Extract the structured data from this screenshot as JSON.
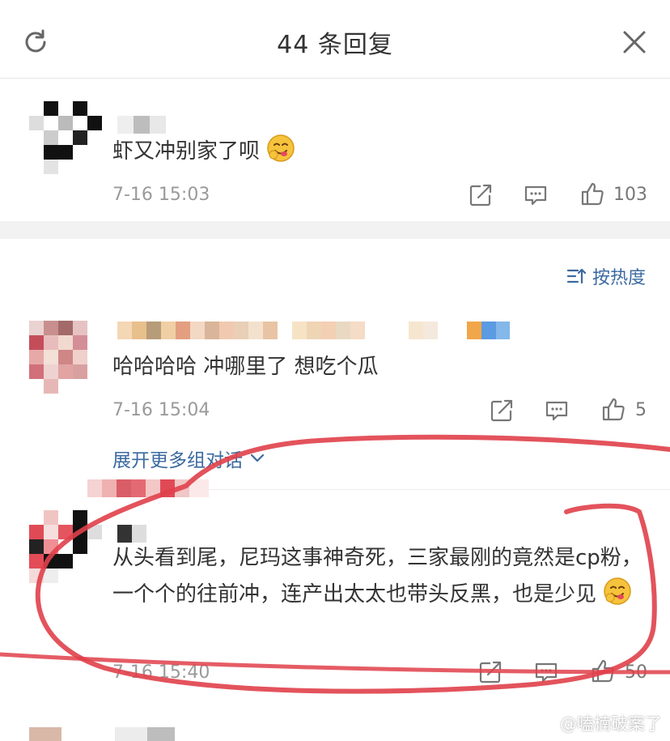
{
  "header": {
    "title": "44 条回复",
    "refresh_icon": "refresh-icon",
    "close_icon": "close-icon"
  },
  "root_comment": {
    "text": "虾又冲别家了呗",
    "emoji": "yummy-face-emoji",
    "time": "7-16 15:03",
    "likes": "103"
  },
  "sort": {
    "label": "按热度",
    "icon": "sort-icon"
  },
  "replies": [
    {
      "text": "哈哈哈哈 冲哪里了 想吃个瓜",
      "time": "7-16 15:04",
      "likes": "5"
    },
    {
      "text": "从头看到尾，尼玛这事神奇死，三家最刚的竟然是cp粉，一个个的往前冲，连产出太太也带头反黑，也是少见",
      "emoji": "yummy-face-emoji",
      "time": "7-16 15:40",
      "likes": "50"
    }
  ],
  "expand": {
    "label": "展开更多组对话"
  },
  "watermark": {
    "text": "@嗑楠破案了"
  },
  "colors": {
    "link": "#3b6aa0",
    "annotation": "#e0404a",
    "muted": "#9a9a9a"
  }
}
